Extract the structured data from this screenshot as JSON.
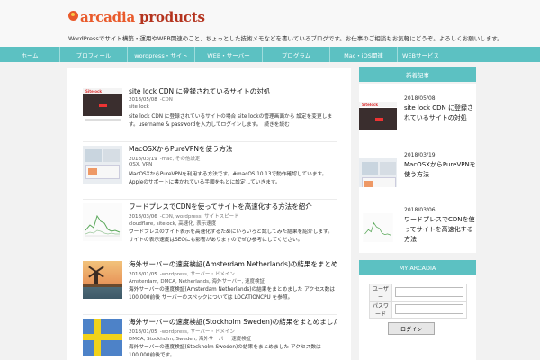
{
  "site": {
    "logo_text_first": "arcadia",
    "logo_text_second": " products",
    "tagline": "WordPressでサイト構築・運用やWEB関連のこと、ちょっとした技術メモなどを書いているブログです。お仕事のご相談もお気軽にどうぞ。よろしくお願いします。"
  },
  "nav": {
    "items": [
      {
        "label": "ホーム"
      },
      {
        "label": "プロフィール"
      },
      {
        "label": "wordpress・サイト"
      },
      {
        "label": "WEB・サーバー"
      },
      {
        "label": "プログラム"
      },
      {
        "label": "Mac・iOS関連"
      },
      {
        "label": "WEBサービス"
      }
    ]
  },
  "posts": [
    {
      "title": "site lock CDN に登録されているサイトの対処",
      "date": "2018/05/08",
      "category": "-CDN",
      "tags": "site lock",
      "excerpt": "site lock CDN に登録されているサイトの場合 site lockの管理画面から 設定を変更します。username & passwordを入力してログインします。　続きを読む"
    },
    {
      "title": "MacOSXからPureVPNを使う方法",
      "date": "2018/03/19",
      "category": "-mac, その他設定",
      "tags": "OSX, VPN",
      "excerpt": "MacOSXからPureVPNを利用する方法です。#macOS 10.13で動作確認しています。　Appleのサポートに書かれている手順をもとに設定していきます。"
    },
    {
      "title": "ワードプレスでCDNを使ってサイトを高速化する方法を紹介",
      "date": "2018/03/06",
      "category": "-CDN, wordpress, サイトスピード",
      "tags": "cloudflare, sitelock, 高速化, 表示速度",
      "excerpt": "ワードプレスのサイト表示を高速化するためにいろいろと試してみた結果を紹介します。サイトの表示速度はSEOにも影響がありますのでぜひ参考にしてください。"
    },
    {
      "title": "海外サーバーの速度検証(Amsterdam Netherlands)の結果をまとめました",
      "date": "2018/01/05",
      "category": "-wordpress, サーバー・ドメイン",
      "tags": "Amsterdam, DMCA, Netherlands, 海外サーバー, 速度検証",
      "excerpt": "海外サーバーの速度検証(Amsterdam Netherlands)の結果をまとめました アクセス数は100,000前後 サーバーのスペックについては LOCATIONCPU を参照。"
    },
    {
      "title": "海外サーバーの速度検証(Stockholm Sweden)の結果をまとめました",
      "date": "2018/01/05",
      "category": "-wordpress, サーバー・ドメイン",
      "tags": "DMCA, Stockholm, Sweden, 海外サーバー, 速度検証",
      "excerpt": "海外サーバーの速度検証(Stockholm Sweden)の結果をまとめました アクセス数は100,000前後です。"
    }
  ],
  "sidebar": {
    "new_heading": "新着記事",
    "items": [
      {
        "date": "2018/05/08",
        "title": "site lock CDN に登録されているサイトの対処"
      },
      {
        "date": "2018/03/19",
        "title": "MacOSXからPureVPNを使う方法"
      },
      {
        "date": "2018/03/06",
        "title": "ワードプレスでCDNを使ってサイトを高速化する方法"
      }
    ],
    "arcadia_heading": "MY ARCADIA",
    "login": {
      "user_label": "ユーザー",
      "pass_label": "パスワード",
      "submit_label": "ログイン"
    }
  },
  "colors": {
    "accent": "#5cc1c2",
    "logo_orange": "#e95a2b",
    "logo_red": "#b4331e",
    "background": "#f2f2f2"
  }
}
